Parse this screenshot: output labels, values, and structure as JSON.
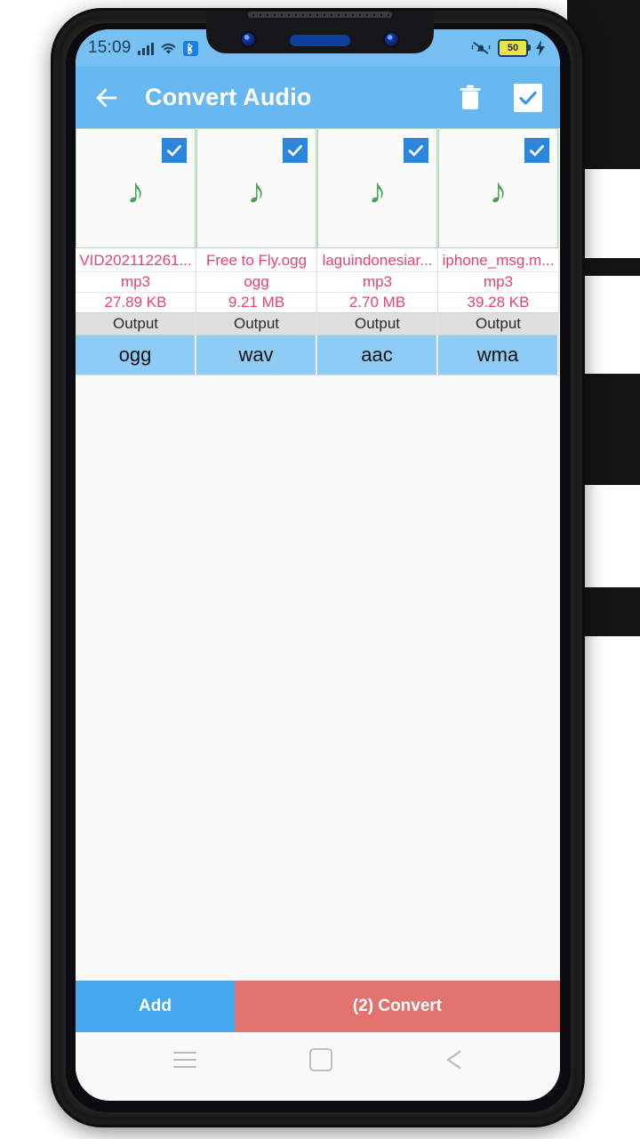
{
  "status_bar": {
    "time": "15:09",
    "battery_level": "50",
    "icons": [
      "signal-bars-icon",
      "wifi-icon",
      "bluetooth-icon",
      "mute-bell-icon",
      "battery-icon",
      "charging-bolt-icon"
    ]
  },
  "app_bar": {
    "title": "Convert Audio",
    "back_icon": "back-arrow-icon",
    "delete_icon": "trash-icon",
    "select_all_icon": "checkbox-checked-icon"
  },
  "files": [
    {
      "name": "VID202112261...",
      "format": "mp3",
      "size": "27.89 KB",
      "output_label": "Output",
      "output_format": "ogg",
      "selected": true,
      "thumb_icon": "music-note-icon"
    },
    {
      "name": "Free to Fly.ogg",
      "format": "ogg",
      "size": "9.21 MB",
      "output_label": "Output",
      "output_format": "wav",
      "selected": true,
      "thumb_icon": "music-note-icon"
    },
    {
      "name": "laguindonesiar...",
      "format": "mp3",
      "size": "2.70 MB",
      "output_label": "Output",
      "output_format": "aac",
      "selected": true,
      "thumb_icon": "music-note-icon"
    },
    {
      "name": "iphone_msg.m...",
      "format": "mp3",
      "size": "39.28 KB",
      "output_label": "Output",
      "output_format": "wma",
      "selected": true,
      "thumb_icon": "music-note-icon"
    }
  ],
  "bottom_bar": {
    "add_label": "Add",
    "convert_label": "(2) Convert"
  },
  "nav_bar": {
    "recents_icon": "recents-icon",
    "home_icon": "home-icon",
    "back_icon": "nav-back-icon"
  },
  "colors": {
    "app_bar": "#67b8f0",
    "status_bar": "#77c0f2",
    "accent_pink": "#e8436f",
    "output_row": "#8ecbf5",
    "add_button": "#44a8ef",
    "convert_button": "#e2736f",
    "note_green": "#45a352",
    "checkbox_blue": "#2b87dd"
  },
  "glyphs": {
    "music_note": "♪"
  }
}
